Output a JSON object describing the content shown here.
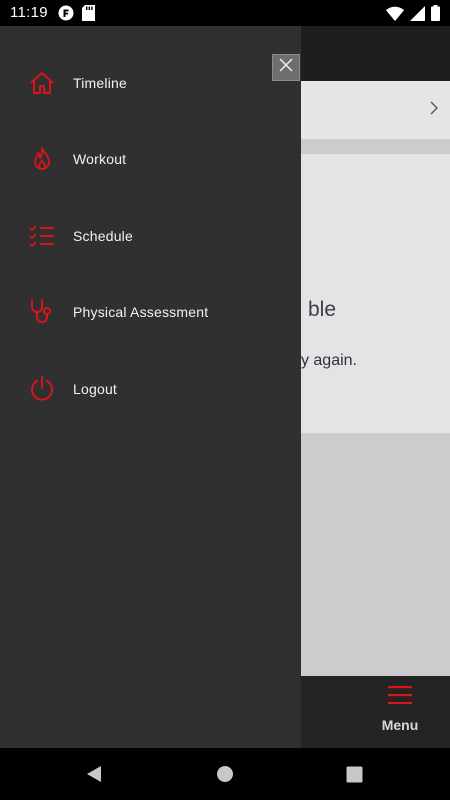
{
  "status_bar": {
    "time": "11:19",
    "icons": [
      "app-notification-icon",
      "sd-card-icon",
      "wifi-icon",
      "cell-signal-icon",
      "battery-icon"
    ]
  },
  "drawer": {
    "items": [
      {
        "label": "Timeline",
        "icon": "home-icon"
      },
      {
        "label": "Workout",
        "icon": "flame-icon"
      },
      {
        "label": "Schedule",
        "icon": "checklist-icon"
      },
      {
        "label": "Physical Assessment",
        "icon": "stethoscope-icon"
      },
      {
        "label": "Logout",
        "icon": "power-icon"
      }
    ],
    "close_icon": "close-icon"
  },
  "background": {
    "card_title": "ble",
    "card_text": "y again.",
    "menu_label": "Menu"
  },
  "colors": {
    "accent": "#d9141b",
    "drawer_bg": "#303030",
    "header_bg": "#1e1e1e",
    "bottom_bar_bg": "#242424"
  }
}
